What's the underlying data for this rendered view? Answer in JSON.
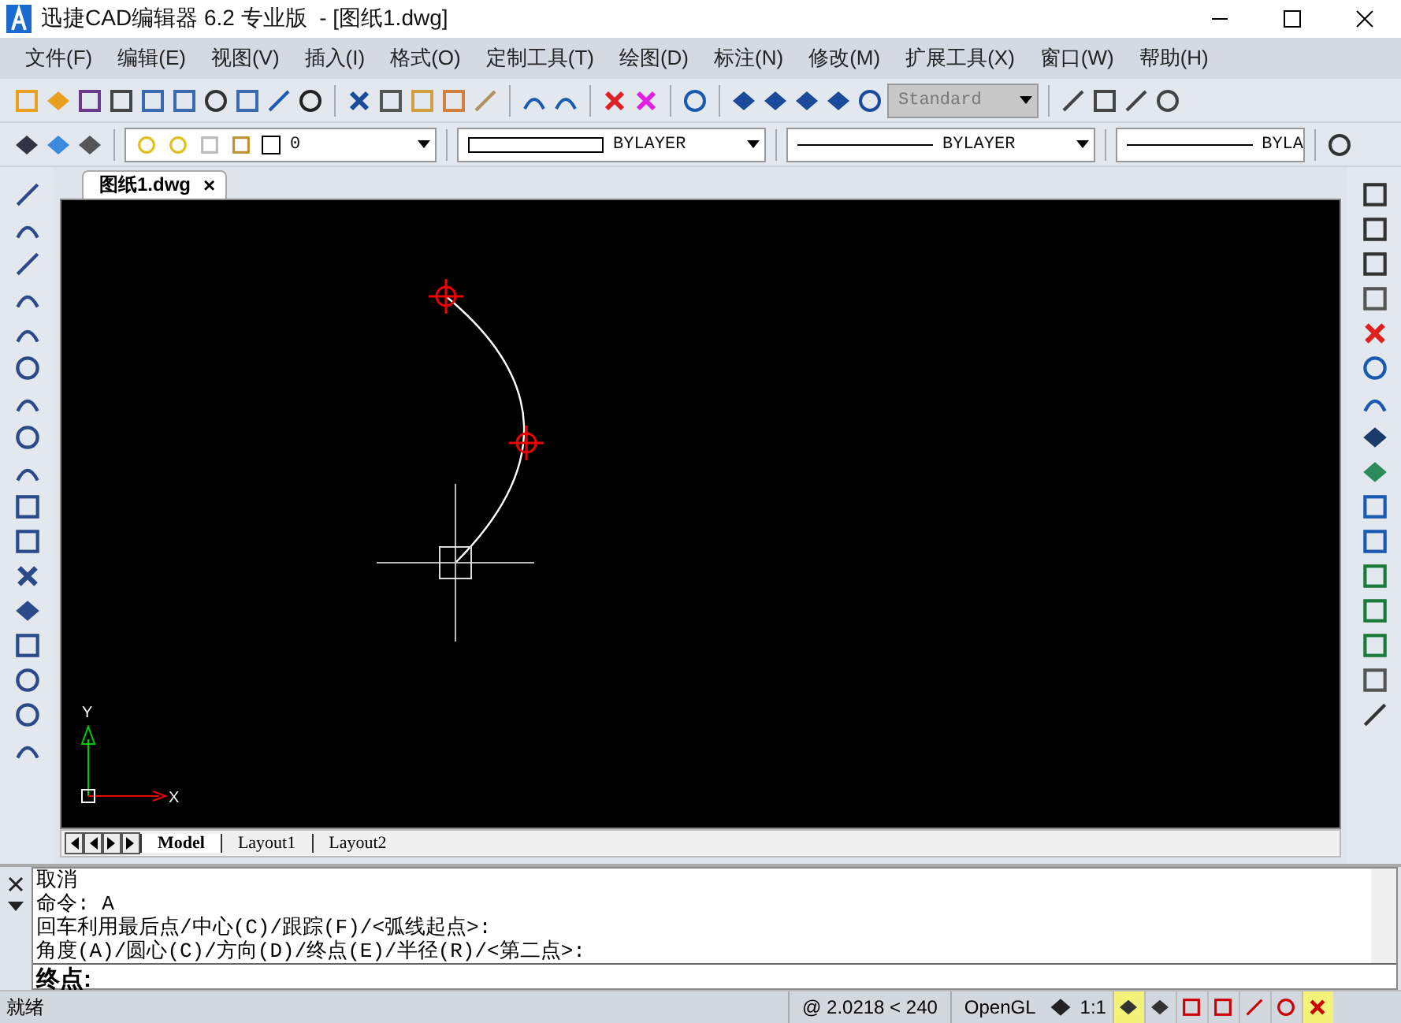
{
  "window": {
    "title": "迅捷CAD编辑器 6.2 专业版  - [图纸1.dwg]"
  },
  "menu": [
    "文件(F)",
    "编辑(E)",
    "视图(V)",
    "插入(I)",
    "格式(O)",
    "定制工具(T)",
    "绘图(D)",
    "标注(N)",
    "修改(M)",
    "扩展工具(X)",
    "窗口(W)",
    "帮助(H)"
  ],
  "toolbar": {
    "text_style": "Standard"
  },
  "layer_bar": {
    "layer": "0",
    "color_setting": "BYLAYER",
    "linetype": "BYLAYER",
    "lineweight": "BYLA"
  },
  "document_tabs": [
    {
      "label": "图纸1.dwg",
      "selected": true,
      "close": "×"
    }
  ],
  "drawing": {
    "axis_x": "X",
    "axis_y": "Y"
  },
  "layout_tabs": [
    {
      "label": "Model",
      "selected": true
    },
    {
      "label": "Layout1",
      "selected": false
    },
    {
      "label": "Layout2",
      "selected": false
    }
  ],
  "command": {
    "history": [
      "取消",
      "命令:  A",
      "回车利用最后点/中心(C)/跟踪(F)/<弧线起点>:",
      "角度(A)/圆心(C)/方向(D)/终点(E)/半径(R)/<第二点>:"
    ],
    "prompt": "终点:"
  },
  "status_bar": {
    "state": "就绪",
    "coordinates": "@ 2.0218 < 240",
    "renderer": "OpenGL",
    "scale": "1:1",
    "toggles": [
      {
        "on": true
      },
      {
        "on": false
      },
      {
        "on": false
      },
      {
        "on": false
      },
      {
        "on": false
      },
      {
        "on": false
      },
      {
        "on": true
      }
    ]
  }
}
